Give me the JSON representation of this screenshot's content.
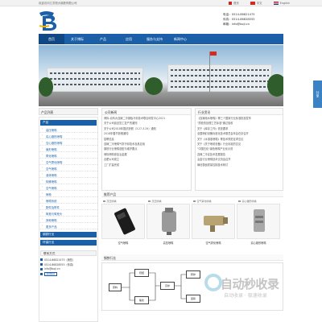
{
  "topbar": {
    "welcome": "欢迎访问江苏恒大钢铁有限公司",
    "links": [
      "中文",
      "English"
    ],
    "home": "首页"
  },
  "header": {
    "tel_label": "电话",
    "tel": "0514-86821475",
    "fax_label": "传真",
    "fax": "0514-86828555",
    "email_label": "邮箱",
    "email": "info@boji.cn"
  },
  "nav": {
    "items": [
      "首页",
      "关于博际",
      "产品",
      "应用",
      "服务与支持",
      "新闻中心"
    ]
  },
  "sidebar": {
    "title": "产品列表",
    "category": "产品",
    "items": [
      "高压喷嘴",
      "实心锥形喷嘴",
      "空心锥形喷嘴",
      "扇形喷嘴",
      "雾化喷嘴",
      "空气雾化喷嘴",
      "空气喷嘴",
      "液体喷嘴",
      "特殊喷嘴",
      "空气喷嘴",
      "喷枪",
      "喷嘴系统",
      "配件及附件",
      "氧枪与氧枪头",
      "其他喷嘴",
      "更多产品"
    ],
    "cat2": "钢铁行业",
    "cat3": "环保行业",
    "contact_title": "联系方式",
    "contact_tel": "0514-86821475（销售）",
    "contact_fax": "0514-86828555（传真）",
    "contact_email": "info@boji.cn",
    "qr_label": "在线留言"
  },
  "news": {
    "title": "公司新闻",
    "items": [
      "博际-北科大连铸二冷钢板冷却技术联合研发中心2021",
      "关于公司延迟复工复产的通知",
      "关于公司2018年国庆放假（3.27-3.29）通知",
      "2018年春节放假通知",
      "招聘信息",
      "连铸二冷喷嘴气雾冷却技术及其应用",
      "钢铁行业喷嘴选型与维护要点",
      "博际喷嘴参加冶金展",
      "合肥公司成立",
      "工厂扩建完成"
    ]
  },
  "industry": {
    "title": "行业资讯",
    "items": [
      "《连铸用水喷嘴》等三个国家行业标准批准发布",
      "\"质检热处理工艺标准\"通过验收",
      "关于《库存工作》督查要求",
      "全国喷射设备标准化技术委员会年会在京召开",
      "关于《水溶液喷嘴》等技术规范征求意见",
      "关于《关于喷射设备》行业标准的意见",
      "\"中国石化\"绿色喷嘴产业化示范",
      "连铸二冷区技术发展报告",
      "冶金行业喷嘴技术交流会召开",
      "铸坯表面质量控制技术研讨"
    ]
  },
  "products": {
    "title": "推荐产品",
    "items": [
      {
        "tag": "高压喷嘴",
        "caption": "空气喷嘴"
      },
      {
        "tag": "高压喷嘴",
        "caption": "高压喷嘴"
      },
      {
        "tag": "空气雾化喷嘴",
        "caption": "空气雾化喷嘴"
      },
      {
        "tag": "实心锥形喷嘴",
        "caption": "实心锥形喷嘴"
      }
    ]
  },
  "steel": {
    "title": "钢铁行业",
    "nodes": [
      "原料",
      "烧结",
      "焦化",
      "高炉",
      "转炉",
      "连铸",
      "热轧",
      "冷轧"
    ]
  },
  "watermark": {
    "big": "自动秒收录",
    "small": "自动收录 · 极速收录"
  },
  "share": "分享",
  "colors": {
    "primary": "#1a5fa8",
    "nav_active": "#0f4884"
  }
}
